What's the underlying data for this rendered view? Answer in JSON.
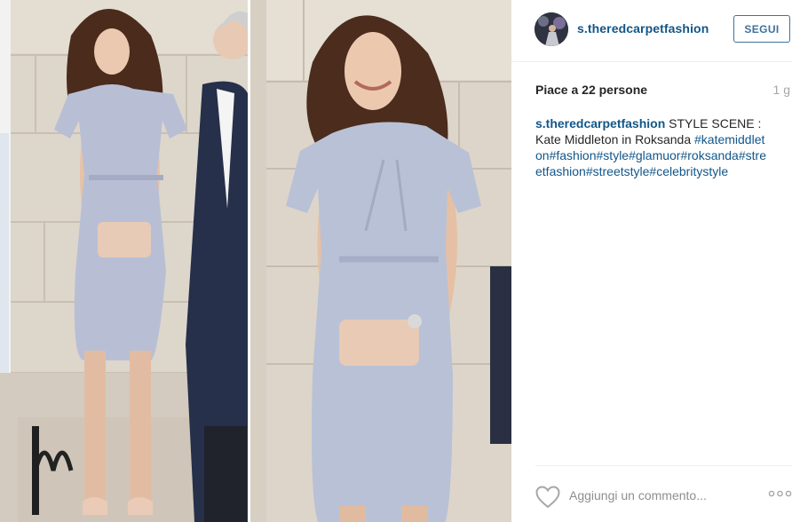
{
  "post": {
    "photo": {
      "description_icon": "photo-collage"
    }
  },
  "header": {
    "username": "s.theredcarpetfashion",
    "follow_label": "SEGUI"
  },
  "stats": {
    "likes_text": "Piace a 22 persone",
    "time_ago": "1 g"
  },
  "caption": {
    "username": "s.theredcarpetfashion",
    "text": " STYLE SCENE : Kate Middleton in Roksanda ",
    "hashtags": [
      "#katemiddleton",
      "#fashion",
      "#style",
      "#glamuor",
      "#roksanda",
      "#streetfashion",
      "#streetstyle",
      "#celebritystyle"
    ]
  },
  "footer": {
    "comment_placeholder": "Aggiungi un commento...",
    "like_icon": "heart-outline-icon",
    "more_icon": "more-options-icon"
  },
  "colors": {
    "link": "#125688",
    "follow_border": "#3f729b",
    "muted": "#a5a7aa",
    "divider": "#efefef"
  }
}
